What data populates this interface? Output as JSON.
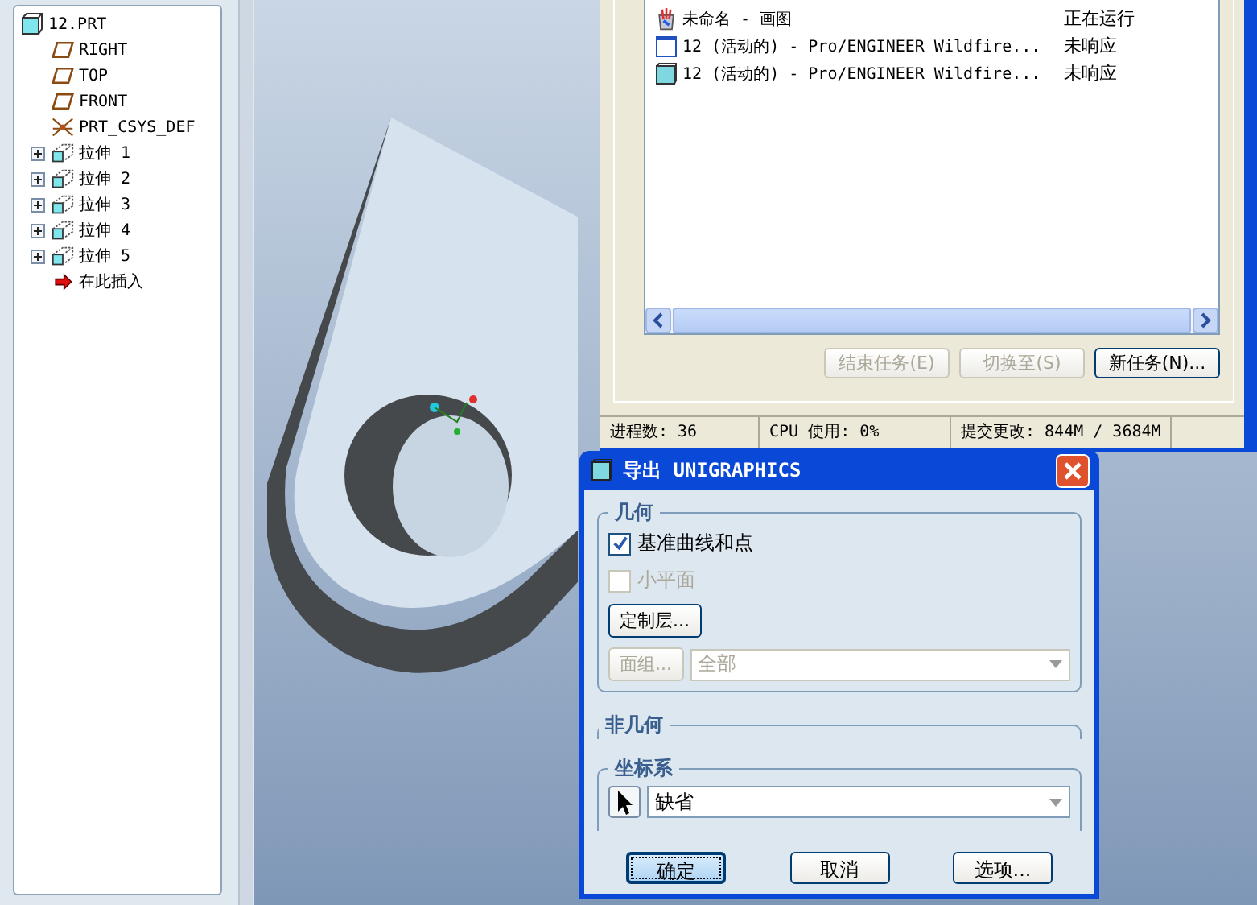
{
  "model_tree": {
    "root": "12.PRT",
    "items": [
      {
        "label": "RIGHT",
        "kind": "plane"
      },
      {
        "label": "TOP",
        "kind": "plane"
      },
      {
        "label": "FRONT",
        "kind": "plane"
      },
      {
        "label": "PRT_CSYS_DEF",
        "kind": "csys"
      },
      {
        "label": "拉伸 1",
        "kind": "feature",
        "expanded": false
      },
      {
        "label": "拉伸 2",
        "kind": "feature",
        "expanded": false
      },
      {
        "label": "拉伸 3",
        "kind": "feature",
        "expanded": false
      },
      {
        "label": "拉伸 4",
        "kind": "feature",
        "expanded": false
      },
      {
        "label": "拉伸 5",
        "kind": "feature",
        "expanded": false
      },
      {
        "label": "在此插入",
        "kind": "insert"
      }
    ]
  },
  "task_manager": {
    "tasks": [
      {
        "name": "未命名 - 画图",
        "status": "正在运行",
        "kind": "paint"
      },
      {
        "name": "12 (活动的) - Pro/ENGINEER Wildfire...",
        "status": "未响应",
        "kind": "window"
      },
      {
        "name": "12 (活动的) - Pro/ENGINEER Wildfire...",
        "status": "未响应",
        "kind": "cube"
      }
    ],
    "buttons": [
      {
        "label": "结束任务(E)",
        "disabled": true
      },
      {
        "label": "切换至(S)",
        "disabled": true
      },
      {
        "label": "新任务(N)...",
        "disabled": false
      }
    ],
    "status_bar": [
      "进程数: 36",
      "CPU 使用: 0%",
      "提交更改: 844M / 3684M"
    ]
  },
  "dialog": {
    "title": "导出 UNIGRAPHICS",
    "geometry": {
      "legend": "几何",
      "checkboxes": [
        {
          "label": "基准曲线和点",
          "checked": true,
          "disabled": false
        },
        {
          "label": "小平面",
          "checked": false,
          "disabled": true
        }
      ],
      "layers_button": "定制层...",
      "quilt_button": {
        "label": "面组...",
        "disabled": true
      },
      "quilt_select": {
        "value": "全部",
        "disabled": true
      }
    },
    "non_geometry": {
      "legend": "非几何"
    },
    "csys": {
      "legend": "坐标系",
      "value": "缺省"
    },
    "buttons": [
      {
        "label": "确定",
        "default": true
      },
      {
        "label": "取消",
        "default": false
      },
      {
        "label": "选项...",
        "default": false
      }
    ]
  }
}
